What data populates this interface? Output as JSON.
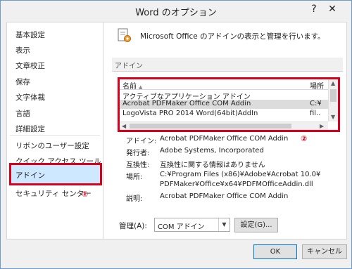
{
  "window": {
    "title": "Word のオプション",
    "help_label": "?",
    "close_label": "✕"
  },
  "sidebar": {
    "items": [
      {
        "label": "基本設定"
      },
      {
        "label": "表示"
      },
      {
        "label": "文章校正"
      },
      {
        "label": "保存"
      },
      {
        "label": "文字体裁"
      },
      {
        "label": "言語"
      },
      {
        "label": "詳細設定"
      },
      {
        "label": "リボンのユーザー設定"
      },
      {
        "label": "クイック アクセス ツール バー"
      },
      {
        "label": "アドイン"
      },
      {
        "label": "セキュリティ センター"
      }
    ],
    "selected": "アドイン",
    "marker": "①"
  },
  "main": {
    "heading": "Microsoft Office のアドインの表示と管理を行います。",
    "section_label": "アドイン",
    "marker": "②",
    "list": {
      "col_name": "名前",
      "col_location": "場所",
      "rows": [
        {
          "name": "アクティブなアプリケーション アドイン",
          "location": ""
        },
        {
          "name": "Acrobat PDFMaker Office COM Addin",
          "location": "C:¥"
        },
        {
          "name": "LogoVista PRO 2014 Word(64bit)AddIn",
          "location": "fil.."
        }
      ]
    },
    "details": {
      "addin_label": "アドイン:",
      "addin_value": "Acrobat PDFMaker Office COM Addin",
      "publisher_label": "発行者:",
      "publisher_value": "Adobe Systems, Incorporated",
      "compat_label": "互換性:",
      "compat_value": "互換性に関する情報はありません",
      "location_label": "場所:",
      "location_value_1": "C:¥Program Files (x86)¥Adobe¥Acrobat 10.0¥",
      "location_value_2": "PDFMaker¥Office¥x64¥PDFMOfficeAddin.dll",
      "desc_label": "説明:",
      "desc_value": "Acrobat PDFMaker Office COM Addin"
    },
    "manage_label": "管理(A):",
    "manage_value": "COM アドイン",
    "go_button": "設定(G)..."
  },
  "footer": {
    "ok_label": "OK",
    "cancel_label": "キャンセル"
  }
}
